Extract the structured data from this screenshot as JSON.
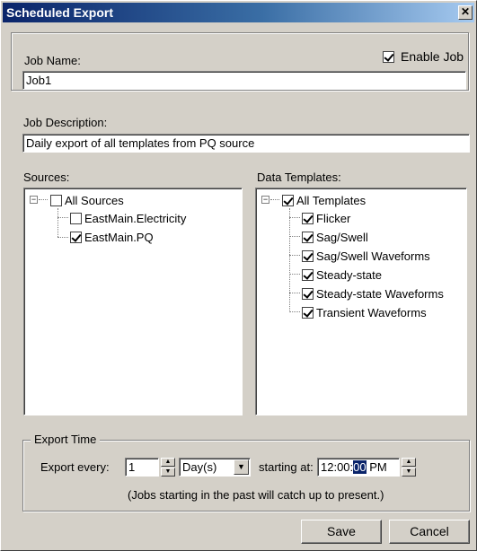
{
  "window": {
    "title": "Scheduled Export",
    "close_glyph": "✕"
  },
  "job": {
    "name_label": "Job Name:",
    "name_value": "Job1",
    "enable_label": "Enable Job",
    "enable_checked": true,
    "description_label": "Job Description:",
    "description_value": "Daily export of all templates from PQ source"
  },
  "sources": {
    "label": "Sources:",
    "root": {
      "label": "All Sources",
      "checked": false,
      "expander": "−"
    },
    "items": [
      {
        "label": "EastMain.Electricity",
        "checked": false
      },
      {
        "label": "EastMain.PQ",
        "checked": true
      }
    ]
  },
  "templates": {
    "label": "Data Templates:",
    "root": {
      "label": "All Templates",
      "checked": true,
      "expander": "−"
    },
    "items": [
      {
        "label": "Flicker",
        "checked": true
      },
      {
        "label": "Sag/Swell",
        "checked": true
      },
      {
        "label": "Sag/Swell Waveforms",
        "checked": true
      },
      {
        "label": "Steady-state",
        "checked": true
      },
      {
        "label": "Steady-state Waveforms",
        "checked": true
      },
      {
        "label": "Transient Waveforms",
        "checked": true
      }
    ]
  },
  "export_time": {
    "group_label": "Export Time",
    "every_label": "Export every:",
    "every_value": "1",
    "unit_value": "Day(s)",
    "starting_label": "starting at:",
    "time_prefix": "12:00:",
    "time_selected": "00",
    "time_suffix": " PM",
    "note": "(Jobs starting in the past will catch up to present.)"
  },
  "buttons": {
    "save": "Save",
    "cancel": "Cancel"
  },
  "glyphs": {
    "spin_up": "▲",
    "spin_down": "▼",
    "combo_arrow": "▼"
  }
}
